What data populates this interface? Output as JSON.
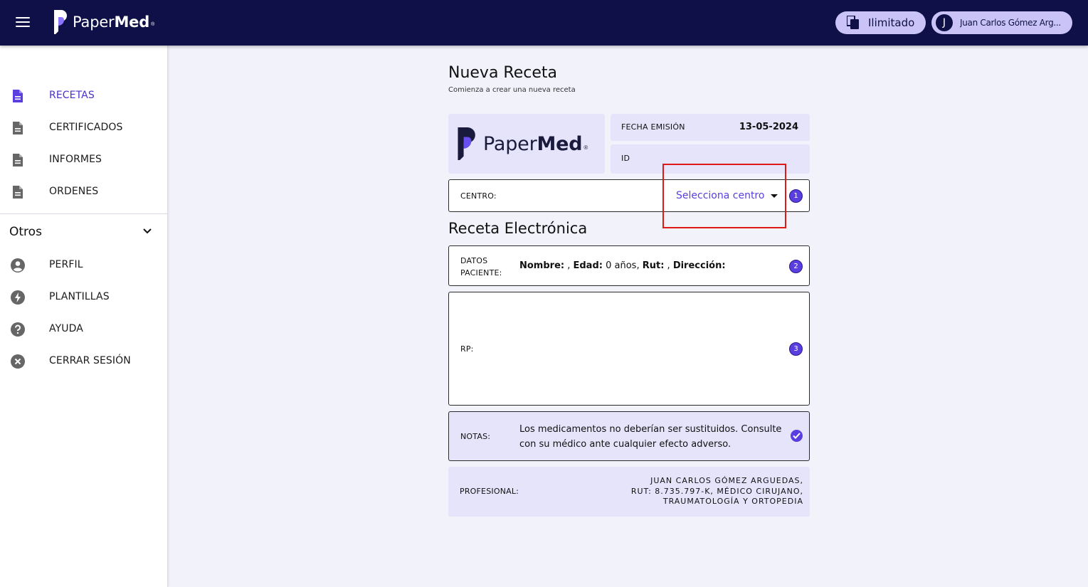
{
  "header": {
    "brand": {
      "light": "Paper",
      "bold": "Med",
      "reg": "®"
    },
    "plan_label": "Ilimitado",
    "user_initial": "J",
    "user_name": "Juan Carlos Gómez Arg..."
  },
  "sidebar": {
    "items": [
      {
        "label": "RECETAS",
        "icon": "document-icon"
      },
      {
        "label": "CERTIFICADOS",
        "icon": "document-icon"
      },
      {
        "label": "INFORMES",
        "icon": "document-icon"
      },
      {
        "label": "ORDENES",
        "icon": "document-icon"
      }
    ],
    "section_label": "Otros",
    "other_items": [
      {
        "label": "PERFIL",
        "icon": "person-icon"
      },
      {
        "label": "PLANTILLAS",
        "icon": "bolt-icon"
      },
      {
        "label": "AYUDA",
        "icon": "help-icon"
      },
      {
        "label": "CERRAR SESIÓN",
        "icon": "close-circle-icon"
      }
    ]
  },
  "main": {
    "title": "Nueva Receta",
    "subtitle": "Comienza a crear una nueva receta",
    "logo": {
      "light": "Paper",
      "bold": "Med",
      "reg": "®"
    },
    "fecha_label": "FECHA EMISIÓN",
    "fecha_value": "13-05-2024",
    "id_label": "ID",
    "centro_label": "CENTRO:",
    "centro_placeholder": "Selecciona centro",
    "section_title": "Receta Electrónica",
    "paciente_label": "DATOS PACIENTE:",
    "paciente": {
      "nombre_label": "Nombre:",
      "edad_label": "Edad:",
      "edad_value": "0 años,",
      "rut_label": "Rut:",
      "direccion_label": "Dirección:"
    },
    "rp_label": "RP:",
    "notas_label": "NOTAS:",
    "notas_text": "Los medicamentos no deberían ser sustituidos. Consulte con su médico ante cualquier efecto adverso.",
    "profesional_label": "PROFESIONAL:",
    "profesional_lines": [
      "JUAN CARLOS GÓMEZ ARGUEDAS,",
      "RUT: 8.735.797-K, MÉDICO CIRUJANO,",
      "TRAUMATOLOGÍA Y ORTOPEDIA"
    ],
    "steps": [
      "1",
      "2",
      "3"
    ]
  },
  "colors": {
    "topbar": "#0f1047",
    "accent": "#5b3ee0",
    "pill": "#c9c3f7",
    "panel": "#e6e4fa",
    "highlight": "#e01818"
  }
}
